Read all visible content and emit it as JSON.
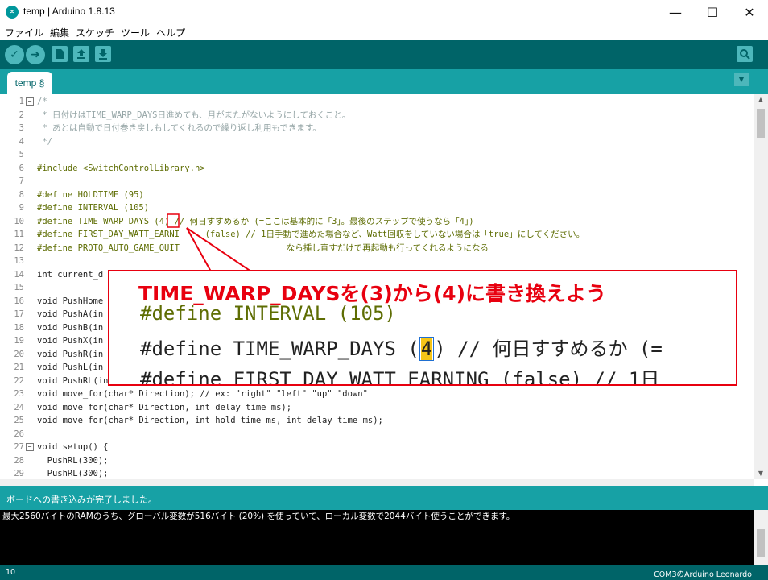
{
  "window": {
    "title": "temp | Arduino 1.8.13",
    "logo_text": "∞",
    "minimize": "—",
    "maximize": "☐",
    "close": "✕"
  },
  "menu": [
    "ファイル",
    "編集",
    "スケッチ",
    "ツール",
    "ヘルプ"
  ],
  "toolbar": {
    "verify_icon": "check-icon",
    "upload_icon": "arrow-right-icon",
    "new_icon": "new-file-icon",
    "open_icon": "open-icon",
    "save_icon": "save-icon",
    "serial_icon": "serial-monitor-icon"
  },
  "tabs": [
    {
      "label": "temp §"
    }
  ],
  "editor": {
    "lines": [
      {
        "n": "1",
        "fold": true,
        "text": "/*",
        "cls": "c-cmt"
      },
      {
        "n": "2",
        "text": " * 日付けはTIME_WARP_DAYS日進めても、月がまたがないようにしておくこと。",
        "cls": "c-cmt"
      },
      {
        "n": "3",
        "text": " * あとは自動で日付巻き戻しもしてくれるので繰り返し利用もできます。",
        "cls": "c-cmt"
      },
      {
        "n": "4",
        "text": " */",
        "cls": "c-cmt"
      },
      {
        "n": "5",
        "text": ""
      },
      {
        "n": "6",
        "text": "#include <SwitchControlLibrary.h>"
      },
      {
        "n": "7",
        "text": ""
      },
      {
        "n": "8",
        "text": "#define HOLDTIME (95)"
      },
      {
        "n": "9",
        "text": "#define INTERVAL (105)"
      },
      {
        "n": "10",
        "text": "#define TIME_WARP_DAYS (4) // 何日すすめるか (=ここは基本的に「3」。最後のステップで使うなら「4」)"
      },
      {
        "n": "11",
        "text": "#define FIRST_DAY_WATT_EARNI     (false) // 1日手動で進めた場合など、Watt回収をしていない場合は「true」にしてください。"
      },
      {
        "n": "12",
        "text": "#define PROTO_AUTO_GAME_QUIT                     なら挿し直すだけで再起動も行ってくれるようになる"
      },
      {
        "n": "13",
        "text": ""
      },
      {
        "n": "14",
        "text": "int current_d"
      },
      {
        "n": "15",
        "text": ""
      },
      {
        "n": "16",
        "text": "void PushHome"
      },
      {
        "n": "17",
        "text": "void PushA(in"
      },
      {
        "n": "18",
        "text": "void PushB(in"
      },
      {
        "n": "19",
        "text": "void PushX(in"
      },
      {
        "n": "20",
        "text": "void PushR(in"
      },
      {
        "n": "21",
        "text": "void PushL(in"
      },
      {
        "n": "22",
        "text": "void PushRL(in"
      },
      {
        "n": "23",
        "text": "void move_for(char* Direction); // ex: \"right\" \"left\" \"up\" \"down\""
      },
      {
        "n": "24",
        "text": "void move_for(char* Direction, int delay_time_ms);"
      },
      {
        "n": "25",
        "text": "void move_for(char* Direction, int hold_time_ms, int delay_time_ms);"
      },
      {
        "n": "26",
        "text": ""
      },
      {
        "n": "27",
        "fold": true,
        "text": "void setup() {"
      },
      {
        "n": "28",
        "text": "  PushRL(300);"
      },
      {
        "n": "29",
        "text": "  PushRL(300);"
      }
    ]
  },
  "callout": {
    "title": "TIME_WARP_DAYSを(3)から(4)に書き換えよう",
    "zoom_line1": "#define INTERVAL (105)",
    "zoom_line2_pre": "#define TIME_WARP_DAYS (",
    "zoom_line2_val": "4",
    "zoom_line2_post": ") // 何日すすめるか (=",
    "zoom_line3": "#define FIRST_DAY_WATT_EARNING (false) // 1日"
  },
  "status": {
    "message": "ボードへの書き込みが完了しました。"
  },
  "console": {
    "text": "最大2560バイトのRAMのうち、グローバル変数が516バイト (20%) を使っていて、ローカル変数で2044バイト使うことができます。"
  },
  "footer": {
    "line_number": "10",
    "board": "COM3のArduino Leonardo"
  }
}
